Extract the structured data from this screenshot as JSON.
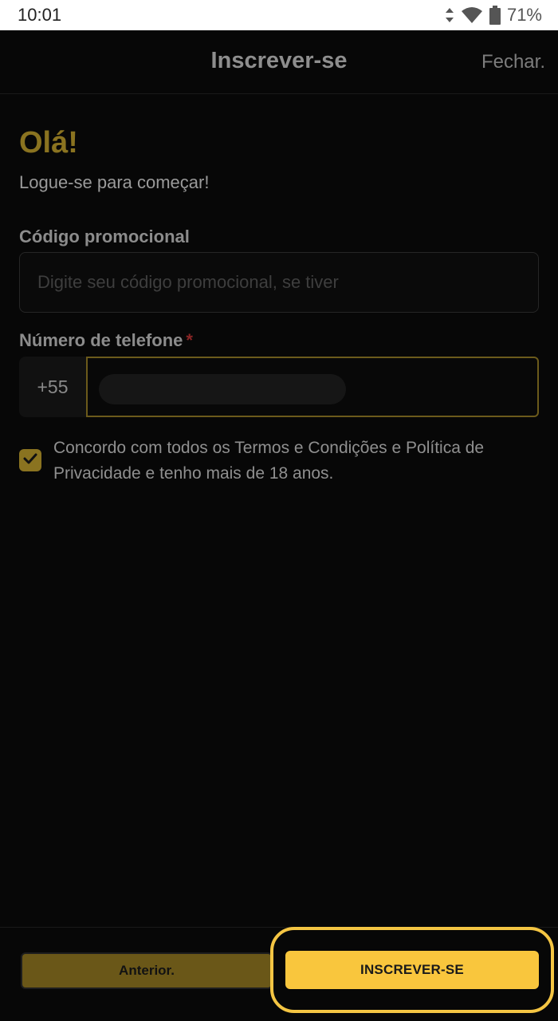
{
  "status_bar": {
    "time": "10:01",
    "battery": "71%",
    "icons": [
      "data-arrows-icon",
      "wifi-icon",
      "battery-icon"
    ]
  },
  "header": {
    "title": "Inscrever-se",
    "close_label": "Fechar."
  },
  "form": {
    "greeting": "Olá!",
    "subtitle": "Logue-se para começar!",
    "promo": {
      "label": "Código promocional",
      "placeholder": "Digite seu código promocional, se tiver",
      "value": ""
    },
    "phone": {
      "label": "Número de telefone",
      "required_mark": "*",
      "country_code": "+55"
    },
    "terms": {
      "checked": true,
      "text": "Concordo com todos os Termos e Condições e Política de Privacidade e tenho mais de 18 anos."
    }
  },
  "footer": {
    "prev_label": "Anterior.",
    "signup_label": "INSCREVER-SE"
  },
  "colors": {
    "accent": "#f9c63d",
    "accent_dim": "#8a7320",
    "background": "#070707"
  }
}
